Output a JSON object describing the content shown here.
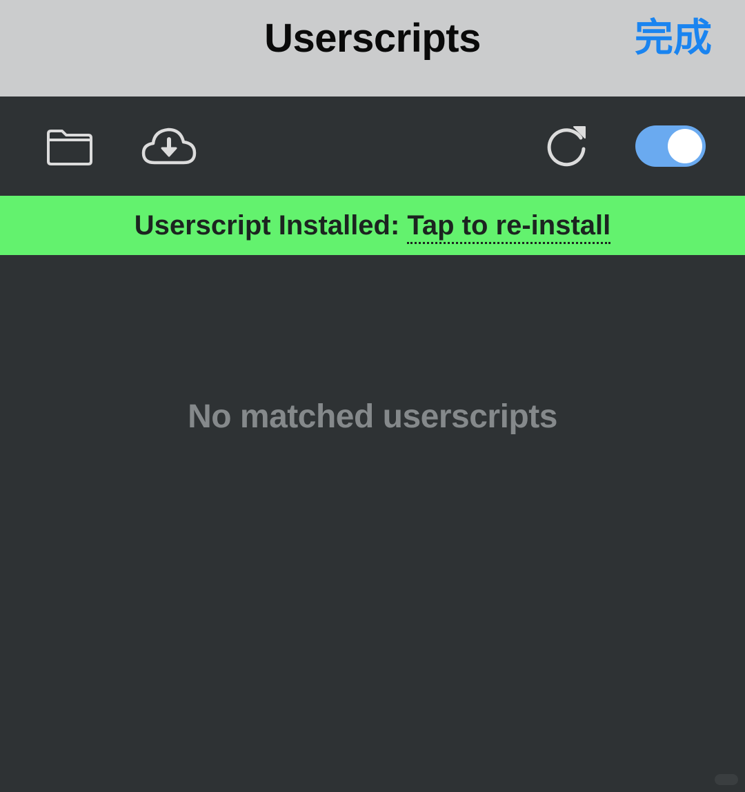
{
  "nav": {
    "title": "Userscripts",
    "done_label": "完成"
  },
  "toolbar": {
    "icons": [
      "folder-icon",
      "cloud-download-icon",
      "refresh-icon"
    ],
    "toggle_on": true
  },
  "banner": {
    "prefix": "Userscript Installed: ",
    "link": "Tap to re-install"
  },
  "main": {
    "empty_message": "No matched userscripts"
  },
  "colors": {
    "nav_background": "#cbcccd",
    "accent_blue": "#1a84f0",
    "toggle_on": "#6aaaf0",
    "banner_green": "#63f26e",
    "app_background": "#2e3234",
    "muted_text": "#85898b"
  }
}
